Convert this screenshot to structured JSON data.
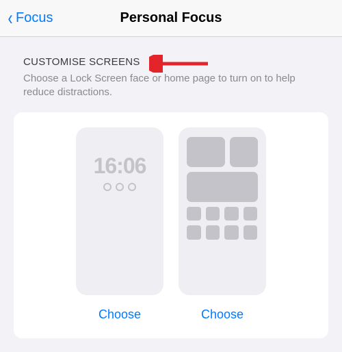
{
  "nav": {
    "back_label": "Focus",
    "title": "Personal Focus"
  },
  "section": {
    "header": "CUSTOMISE SCREENS",
    "subtitle": "Choose a Lock Screen face or home page to turn on to help reduce distractions."
  },
  "screens": {
    "lock": {
      "time": "16:06",
      "choose_label": "Choose"
    },
    "home": {
      "choose_label": "Choose"
    }
  }
}
